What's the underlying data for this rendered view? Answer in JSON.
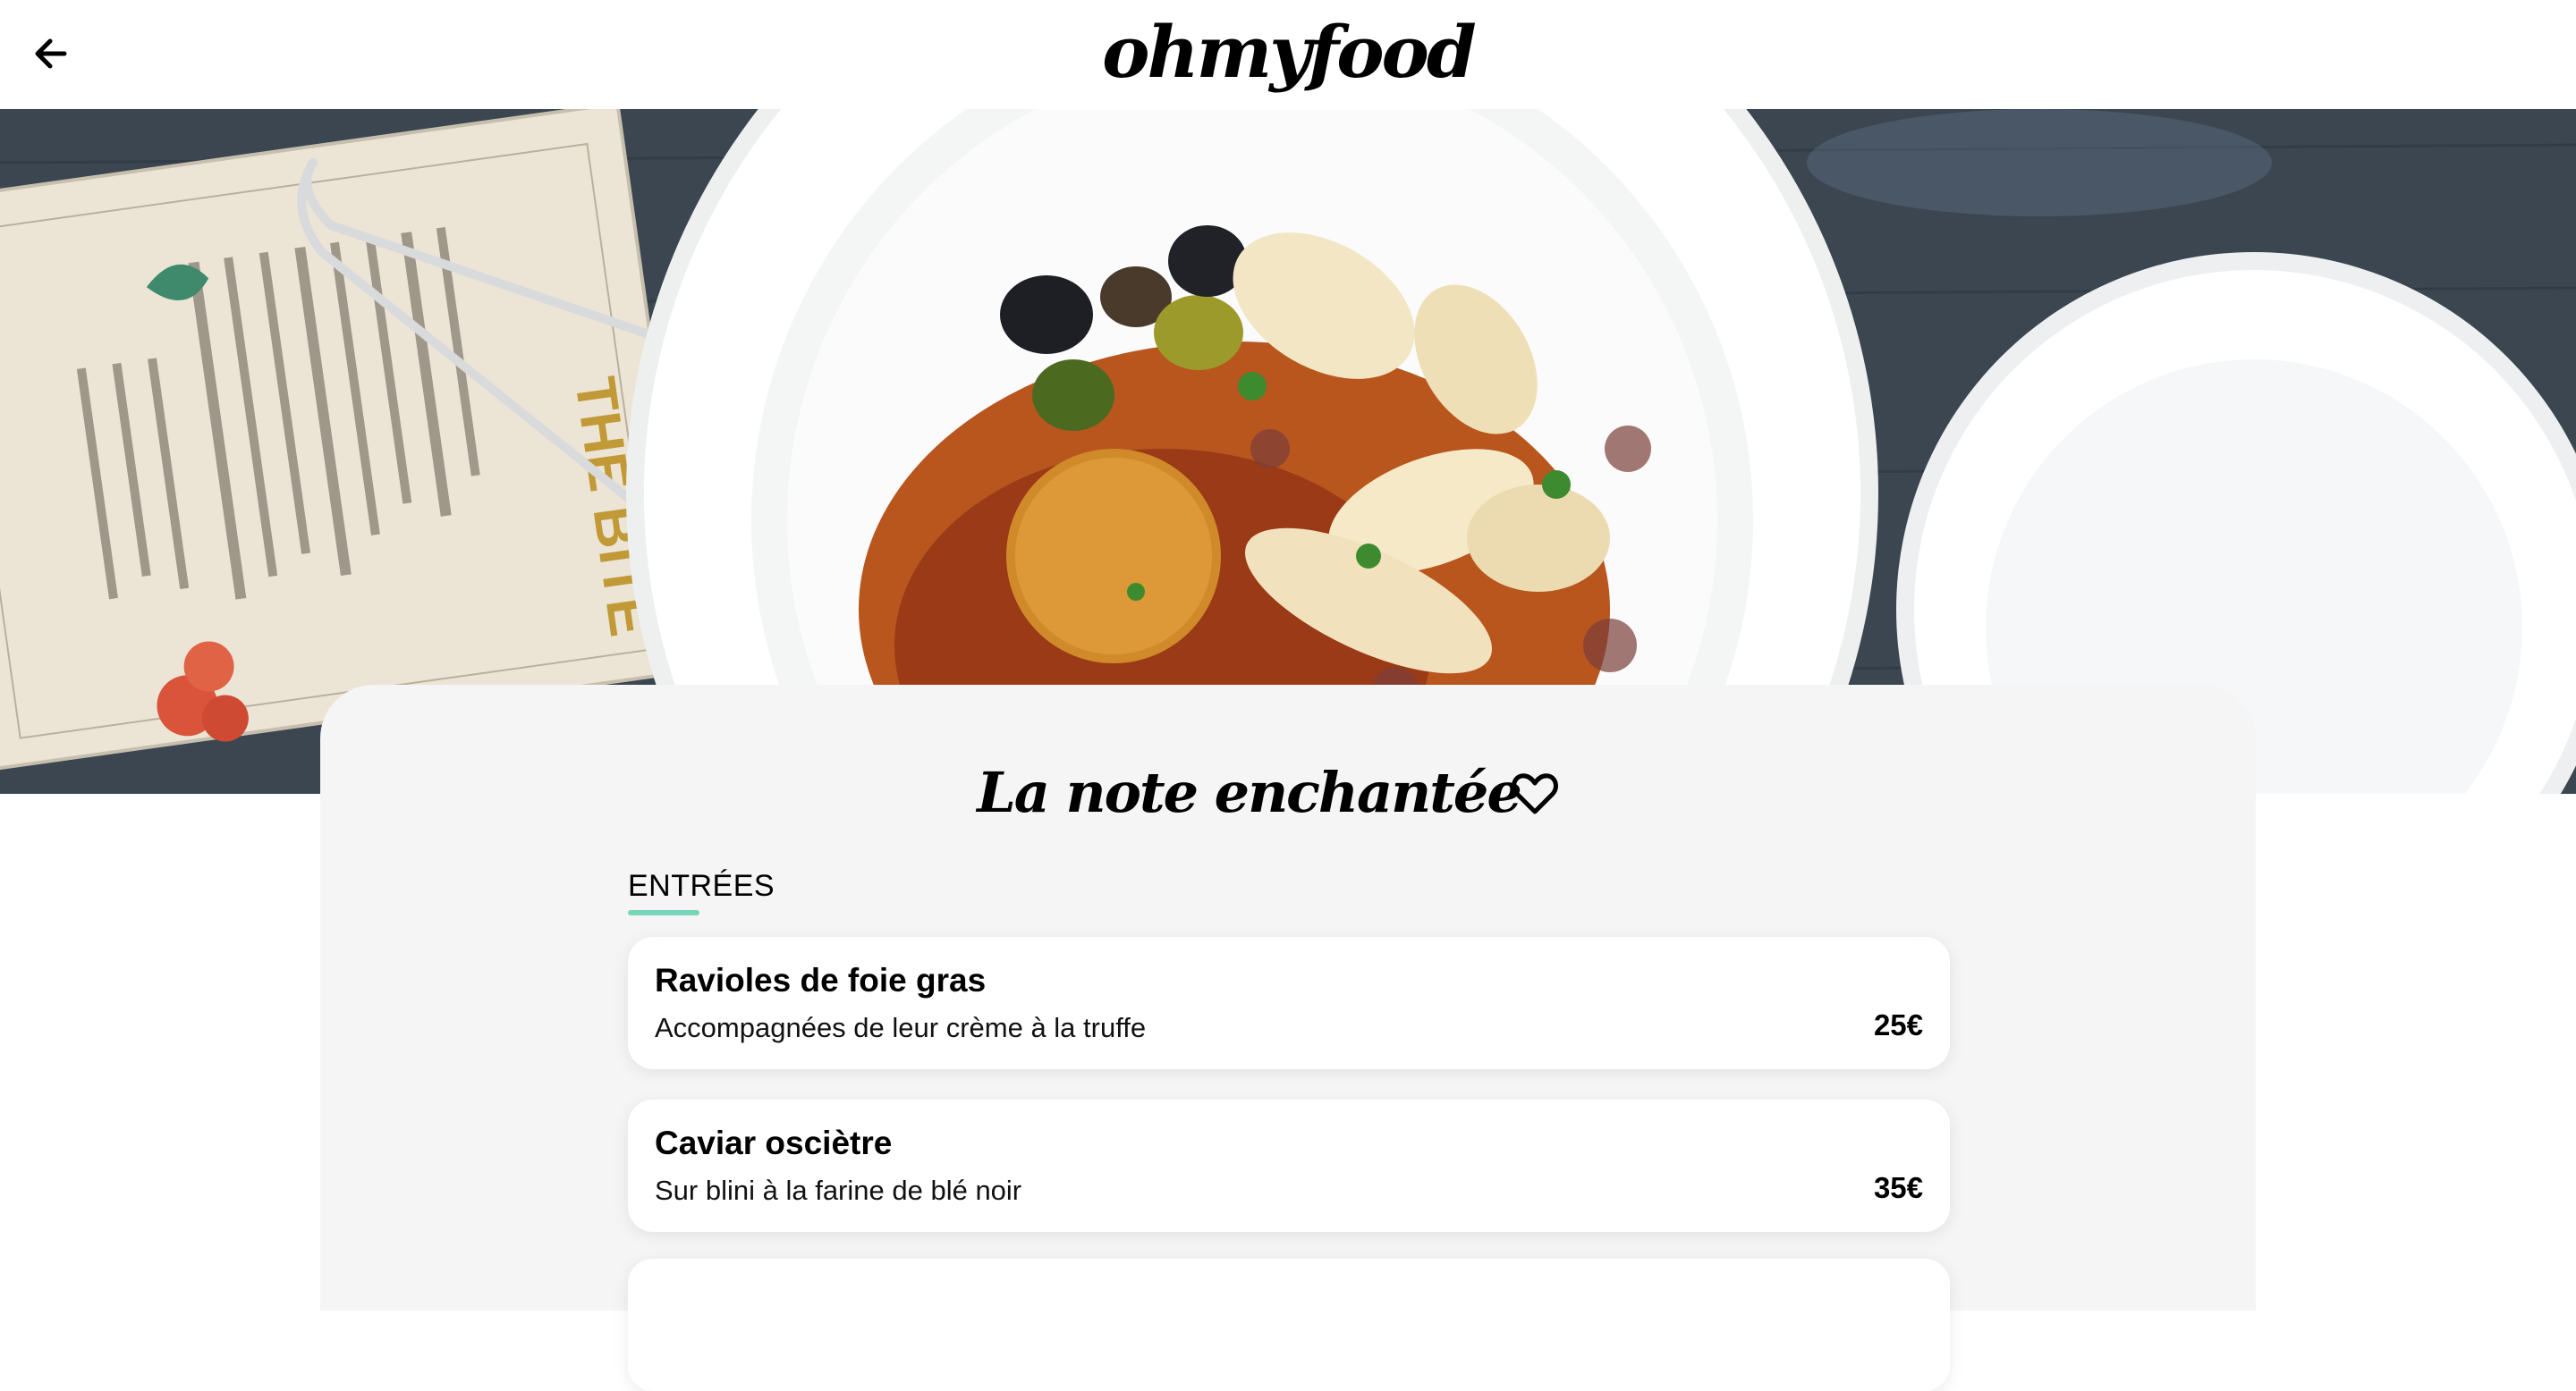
{
  "header": {
    "logo": "ohmyfood",
    "back_icon": "arrow-left-icon"
  },
  "hero": {
    "image": "food-plate-photo"
  },
  "restaurant": {
    "name": "La note enchantée",
    "favorite_icon": "heart-outline-icon"
  },
  "menu": {
    "section_label": "ENTRÉES",
    "dishes": [
      {
        "name": "Ravioles de foie gras",
        "description": "Accompagnées de leur crème à la truffe",
        "price": "25€"
      },
      {
        "name": "Caviar osciètre",
        "description": "Sur blini à la farine de blé noir",
        "price": "35€"
      }
    ]
  },
  "colors": {
    "accent": "#78d5b9",
    "card_background": "#f5f5f5",
    "page_background": "#ffffff"
  }
}
